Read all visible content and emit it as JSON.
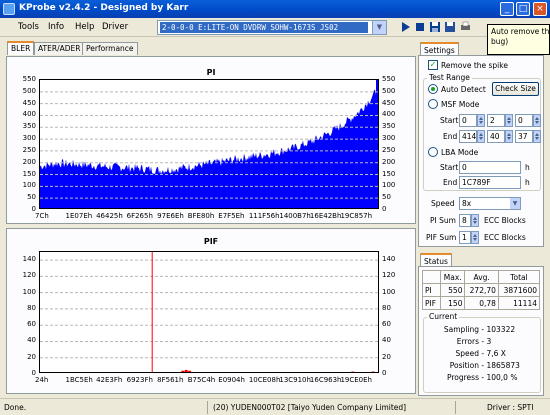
{
  "window": {
    "title": "KProbe v2.4.2 - Designed by Karr"
  },
  "menu": {
    "items": [
      "Tools",
      "Info",
      "Help",
      "Driver"
    ]
  },
  "drive": {
    "selected": "2-0-0-0 E:LITE-ON DVDRW SOHW-1673S JS02"
  },
  "tooltip": {
    "line1": "Auto remove the s",
    "line2": "bug)"
  },
  "tabs": [
    "BLER",
    "ATER/ADER",
    "Performance"
  ],
  "colors": {
    "pi_series": "#0000ff",
    "pif_series": "#ff0000",
    "accent_tab": "#e68b2c"
  },
  "chart_data": [
    {
      "type": "area",
      "title": "PI",
      "ylim": [
        0,
        550
      ],
      "yticks": [
        0,
        50,
        100,
        150,
        200,
        250,
        300,
        350,
        400,
        450,
        500,
        550
      ],
      "xtick_labels": [
        "7Ch",
        "1E07Eh",
        "46425h",
        "6F265h",
        "97E6Eh",
        "BFE80h",
        "E7F5Eh",
        "111F56h",
        "1400B7h",
        "16E42Bh",
        "19C857h"
      ],
      "grid": true,
      "x": [
        0.0,
        0.05,
        0.1,
        0.15,
        0.2,
        0.25,
        0.3,
        0.35,
        0.4,
        0.45,
        0.5,
        0.55,
        0.6,
        0.65,
        0.7,
        0.75,
        0.8,
        0.85,
        0.88,
        0.91,
        0.94,
        0.97,
        1.0
      ],
      "y": [
        185,
        198,
        195,
        190,
        183,
        180,
        176,
        168,
        174,
        186,
        195,
        208,
        222,
        232,
        246,
        264,
        290,
        326,
        352,
        382,
        418,
        468,
        520
      ]
    },
    {
      "type": "area",
      "title": "PIF",
      "ylim": [
        0,
        150
      ],
      "yticks": [
        0,
        20,
        40,
        60,
        80,
        100,
        120,
        140
      ],
      "xtick_labels": [
        "24h",
        "1BC5Eh",
        "42E3Fh",
        "6923Fh",
        "8F561h",
        "B75C4h",
        "E0904h",
        "10CE08h",
        "13C910h",
        "16C963h",
        "19CE0Eh"
      ],
      "grid": true,
      "spikes": [
        {
          "x": 0.33,
          "y": 150
        },
        {
          "x": 0.42,
          "y": 4
        },
        {
          "x": 0.43,
          "y": 5
        },
        {
          "x": 0.44,
          "y": 4
        },
        {
          "x": 0.52,
          "y": 2
        },
        {
          "x": 0.6,
          "y": 2
        },
        {
          "x": 0.68,
          "y": 1
        },
        {
          "x": 0.75,
          "y": 2
        },
        {
          "x": 0.82,
          "y": 1
        },
        {
          "x": 0.88,
          "y": 2
        },
        {
          "x": 0.92,
          "y": 3
        },
        {
          "x": 0.95,
          "y": 2
        },
        {
          "x": 0.98,
          "y": 3
        }
      ]
    }
  ],
  "settings": {
    "tab_label": "Settings",
    "remove_spike_label": "Remove the spike",
    "remove_spike_checked": true,
    "test_range_label": "Test Range",
    "auto_detect_label": "Auto Detect",
    "check_size_label": "Check Size",
    "msf_mode_label": "MSF Mode",
    "start_label": "Start",
    "end_label": "End",
    "msf_start": [
      "0",
      "2",
      "0"
    ],
    "msf_end": [
      "414",
      "40",
      "37"
    ],
    "lba_mode_label": "LBA Mode",
    "lba_start": "0",
    "lba_end": "1C789F",
    "h_label": "h",
    "speed_label": "Speed",
    "speed_value": "8x",
    "pi_sum_label": "PI Sum",
    "pi_sum_value": "8",
    "pif_sum_label": "PIF Sum",
    "pif_sum_value": "1",
    "ecc_blocks_label": "ECC Blocks"
  },
  "status": {
    "tab_label": "Status",
    "headers": [
      "Max.",
      "Avg.",
      "Total"
    ],
    "rows": [
      {
        "name": "PI",
        "max": "550",
        "avg": "272,70",
        "total": "3871600"
      },
      {
        "name": "PIF",
        "max": "150",
        "avg": "0,78",
        "total": "11114"
      }
    ],
    "current_label": "Current",
    "current": [
      {
        "key": "Sampling",
        "value": "103322"
      },
      {
        "key": "Errors",
        "value": "3"
      },
      {
        "key": "Speed",
        "value": "7,6  X"
      },
      {
        "key": "Position",
        "value": "1865873"
      },
      {
        "key": "Progress",
        "value": "100,0 %"
      }
    ]
  },
  "statusbar": {
    "left": "Done.",
    "media": "(20) YUDEN000T02 [Taiyo Yuden Company Limited]",
    "driver": "Driver : SPTI"
  }
}
